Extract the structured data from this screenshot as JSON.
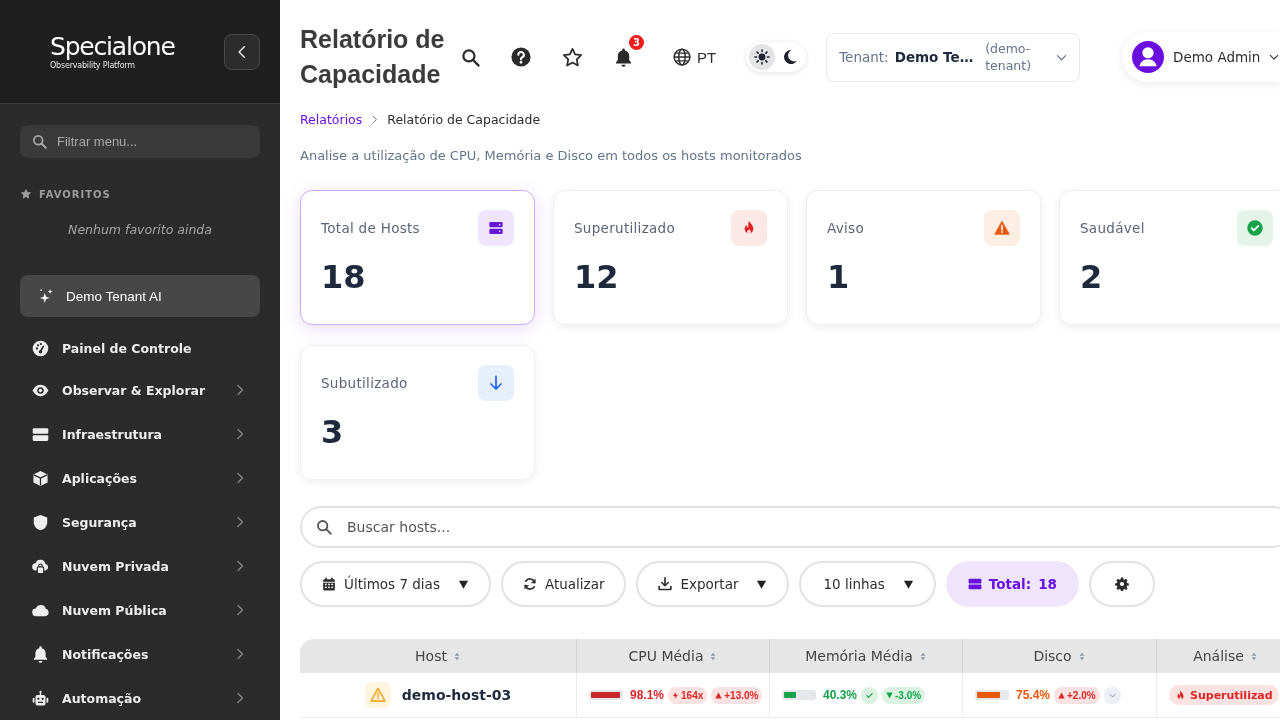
{
  "sidebar": {
    "logo": {
      "name": "Specialone",
      "tagline": "Observability Platform"
    },
    "filter": {
      "placeholder": "Filtrar menu..."
    },
    "favorites": {
      "title": "FAVORITOS",
      "empty_text": "Nenhum favorito ainda"
    },
    "assistant_button": "Demo Tenant AI",
    "nav": [
      {
        "label": "Painel de Controle",
        "expandable": false
      },
      {
        "label": "Observar & Explorar",
        "expandable": true
      },
      {
        "label": "Infraestrutura",
        "expandable": true
      },
      {
        "label": "Aplicações",
        "expandable": true
      },
      {
        "label": "Segurança",
        "expandable": true
      },
      {
        "label": "Nuvem Privada",
        "expandable": true
      },
      {
        "label": "Nuvem Pública",
        "expandable": true
      },
      {
        "label": "Notificações",
        "expandable": true
      },
      {
        "label": "Automação",
        "expandable": true
      }
    ]
  },
  "header": {
    "title": "Relatório de Capacidade",
    "notifications": {
      "count": "3"
    },
    "language": "PT",
    "theme": [
      {
        "kind": "light",
        "selected": true
      },
      {
        "kind": "dark",
        "selected": false
      }
    ],
    "tenant": {
      "label": "Tenant:",
      "name": "Demo Te…",
      "id": "(demo-tenant)"
    },
    "user": {
      "name": "Demo Admin"
    }
  },
  "breadcrumb": [
    {
      "label": "Relatórios",
      "current": false
    },
    {
      "label": "Relatório de Capacidade",
      "current": true
    }
  ],
  "description": "Analise a utilização de CPU, Memória e Disco em todos os hosts monitorados",
  "cards": [
    {
      "kind": "total",
      "label": "Total de Hosts",
      "value": "18",
      "selected": true
    },
    {
      "kind": "over",
      "label": "Superutilizado",
      "value": "12",
      "selected": false
    },
    {
      "kind": "warning",
      "label": "Aviso",
      "value": "1",
      "selected": false
    },
    {
      "kind": "healthy",
      "label": "Saudável",
      "value": "2",
      "selected": false
    },
    {
      "kind": "under",
      "label": "Subutilizado",
      "value": "3",
      "selected": false
    }
  ],
  "search": {
    "placeholder": "Buscar hosts..."
  },
  "toolbar": [
    {
      "kind": "period",
      "label": "Últimos 7 dias",
      "dropdown": true
    },
    {
      "kind": "refresh",
      "label": "Atualizar",
      "dropdown": false
    },
    {
      "kind": "export",
      "label": "Exportar",
      "dropdown": true
    },
    {
      "kind": "rows",
      "label": "10 linhas",
      "dropdown": true
    },
    {
      "kind": "total",
      "label": "Total:",
      "value": "18",
      "dropdown": false
    },
    {
      "kind": "settings",
      "dropdown": false
    }
  ],
  "table": {
    "columns": [
      "Host",
      "CPU Média",
      "Memória Média",
      "Disco",
      "Análise"
    ],
    "rows": [
      {
        "kind": "warning",
        "host": "demo-host-03",
        "cpu": {
          "kind": "critical",
          "level": 0.981,
          "reading": "98.1%",
          "badges": [
            {
              "kind": "spike",
              "text": "164x"
            },
            {
              "kind": "up",
              "text": "+13.0%"
            }
          ]
        },
        "memory": {
          "kind": "ok",
          "level": 0.403,
          "reading": "40.3%",
          "badges": [
            {
              "kind": "ok"
            },
            {
              "kind": "down",
              "text": "-3.0%"
            }
          ]
        },
        "disk": {
          "kind": "warning",
          "level": 0.754,
          "reading": "75.4%",
          "badges": [
            {
              "kind": "up",
              "text": "+2.0%"
            },
            {
              "kind": "more"
            }
          ]
        },
        "analysis": {
          "kind": "over",
          "label": "Superutilizad"
        }
      }
    ]
  }
}
